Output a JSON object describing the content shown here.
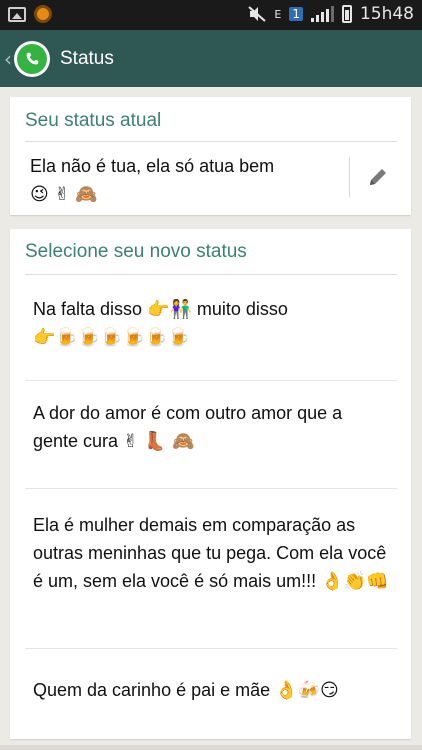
{
  "status_bar": {
    "time": "15h48",
    "sim": "1",
    "network": "E"
  },
  "action_bar": {
    "title": "Status",
    "back_glyph": "‹"
  },
  "current_status": {
    "header": "Seu status atual",
    "text": "Ela não é tua, ela só atua bem",
    "emojis": "😉 ✌ 🙈"
  },
  "new_status": {
    "header": "Selecione seu novo status",
    "items": [
      {
        "text": "Na falta disso 👉👫 muito disso",
        "emojis": "👉🍺🍺🍺🍺🍺🍺"
      },
      {
        "text": "A dor do amor é com outro amor que a gente cura",
        "emojis": "✌ 👢 🙈"
      },
      {
        "text": "Ela é mulher demais em comparação as outras meninhas que tu pega. Com ela você é um, sem ela você é só mais um!!!",
        "emojis": "👌👏👊"
      },
      {
        "text": "Quem da carinho é pai e mãe",
        "emojis": "👌🍻😏"
      }
    ]
  },
  "colors": {
    "action_bar": "#2f5855",
    "accent": "#3b8276",
    "whatsapp_green": "#35b340",
    "background": "#eceae4"
  },
  "icons": {
    "back": "chevron-left-icon",
    "logo": "whatsapp-logo-icon",
    "edit": "pencil-icon"
  }
}
